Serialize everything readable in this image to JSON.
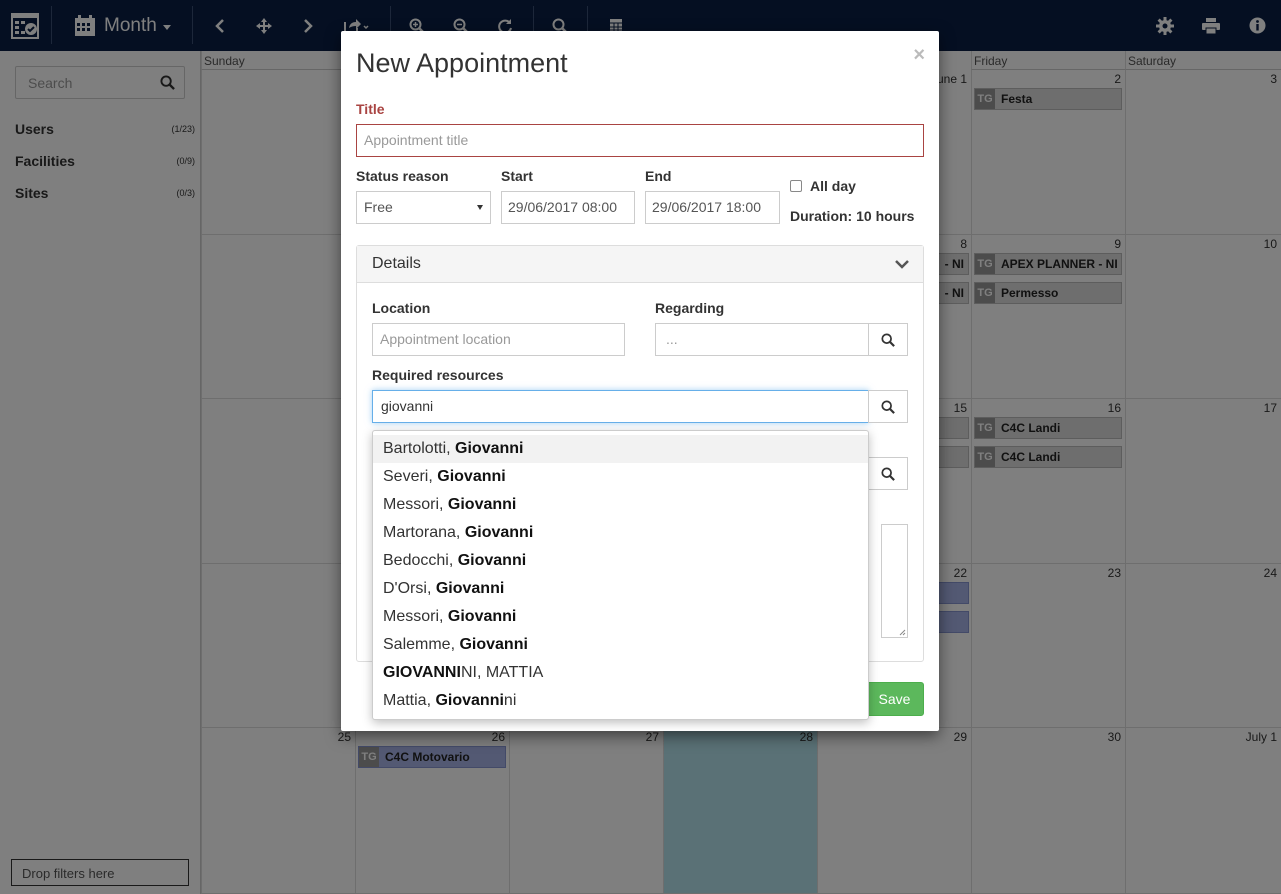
{
  "toolbar": {
    "view_label": "Month",
    "colors": {
      "bg": "#0a1f44"
    }
  },
  "sidebar": {
    "search_placeholder": "Search",
    "items": [
      {
        "label": "Users",
        "count": "(1/23)"
      },
      {
        "label": "Facilities",
        "count": "(0/9)"
      },
      {
        "label": "Sites",
        "count": "(0/3)"
      }
    ],
    "drop_filters": "Drop filters here"
  },
  "calendar": {
    "day_headers": [
      "Sunday",
      "",
      "",
      "",
      "",
      "Friday",
      "Saturday"
    ],
    "day_numbers": {
      "r1": [
        "",
        "",
        "",
        "",
        "une 1",
        "2",
        "3"
      ],
      "r2": [
        "",
        "",
        "",
        "",
        "8",
        "9",
        "10"
      ],
      "r3": [
        "",
        "",
        "",
        "",
        "15",
        "16",
        "17"
      ],
      "r4": [
        "",
        "",
        "",
        "",
        "22",
        "23",
        "24"
      ],
      "r5": [
        "25",
        "26",
        "27",
        "28",
        "29",
        "30",
        "July 1"
      ]
    },
    "events": {
      "festa": "Festa",
      "apex": "APEX PLANNER - NI",
      "ni1": "- NI",
      "ni2": "- NI",
      "permesso": "Permesso",
      "landi1": "C4C Landi",
      "landi2": "C4C Landi",
      "motovario": "C4C Motovario",
      "tg": "TG"
    }
  },
  "modal": {
    "title": "New Appointment",
    "close": "×",
    "title_label": "Title",
    "title_placeholder": "Appointment title",
    "status_label": "Status reason",
    "status_value": "Free",
    "start_label": "Start",
    "start_value": "29/06/2017 08:00",
    "end_label": "End",
    "end_value": "29/06/2017 18:00",
    "allday_label": "All day",
    "duration": "Duration: 10 hours",
    "details_label": "Details",
    "location_label": "Location",
    "location_placeholder": "Appointment location",
    "regarding_label": "Regarding",
    "regarding_placeholder": "...",
    "resources_label": "Required resources",
    "resources_value": "giovanni",
    "save_label": "Save"
  },
  "autocomplete": [
    {
      "pre": "Bartolotti, ",
      "match": "Giovanni",
      "post": ""
    },
    {
      "pre": "Severi, ",
      "match": "Giovanni",
      "post": ""
    },
    {
      "pre": "Messori, ",
      "match": "Giovanni",
      "post": ""
    },
    {
      "pre": "Martorana, ",
      "match": "Giovanni",
      "post": ""
    },
    {
      "pre": "Bedocchi, ",
      "match": "Giovanni",
      "post": ""
    },
    {
      "pre": "D'Orsi, ",
      "match": "Giovanni",
      "post": ""
    },
    {
      "pre": "Messori, ",
      "match": "Giovanni",
      "post": ""
    },
    {
      "pre": "Salemme, ",
      "match": "Giovanni",
      "post": ""
    },
    {
      "pre": "",
      "match": "GIOVANNI",
      "post": "NI, MATTIA"
    },
    {
      "pre": "Mattia, ",
      "match": "Giovanni",
      "post": "ni"
    }
  ]
}
